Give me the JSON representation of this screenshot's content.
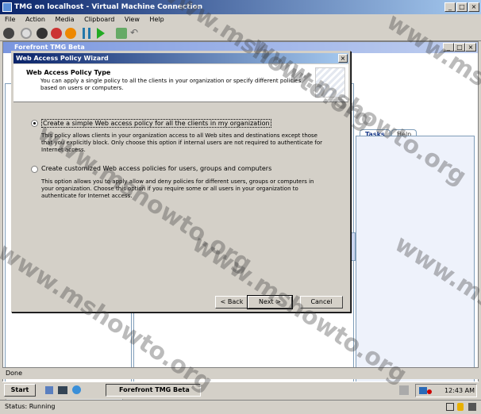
{
  "vm_window": {
    "title": "TMG on localhost - Virtual Machine Connection",
    "menu": [
      "File",
      "Action",
      "Media",
      "Clipboard",
      "View",
      "Help"
    ],
    "status": "Status: Running"
  },
  "guest": {
    "app_title": "Forefront TMG Beta",
    "tabs": [
      "Tasks",
      "Help"
    ],
    "status_bar": "Done",
    "taskbar": {
      "start_label": "Start",
      "task_item": "Forefront TMG Beta",
      "clock": "12:43 AM"
    }
  },
  "wizard": {
    "title": "Web Access Policy Wizard",
    "header_title": "Web Access Policy Type",
    "header_desc": "You can apply a single policy to all the clients in your organization or specify different policies based on users or computers.",
    "options": [
      {
        "label": "Create a simple Web access policy for all the clients in my organization",
        "desc": "This policy allows clients in your organization access to all Web sites and destinations except those that you explicitly block. Only choose this option if internal users are not required to authenticate for Internet access.",
        "selected": true
      },
      {
        "label": "Create customized Web access policies for users, groups and computers",
        "desc": "This option allows you to apply allow and deny policies for different users, groups or computers in your organization. Choose this option if you require some or all users in your organization to authenticate for Internet access.",
        "selected": false
      }
    ],
    "buttons": {
      "back": "< Back",
      "next": "Next >",
      "cancel": "Cancel"
    }
  },
  "watermark": "www.mshowto.org"
}
